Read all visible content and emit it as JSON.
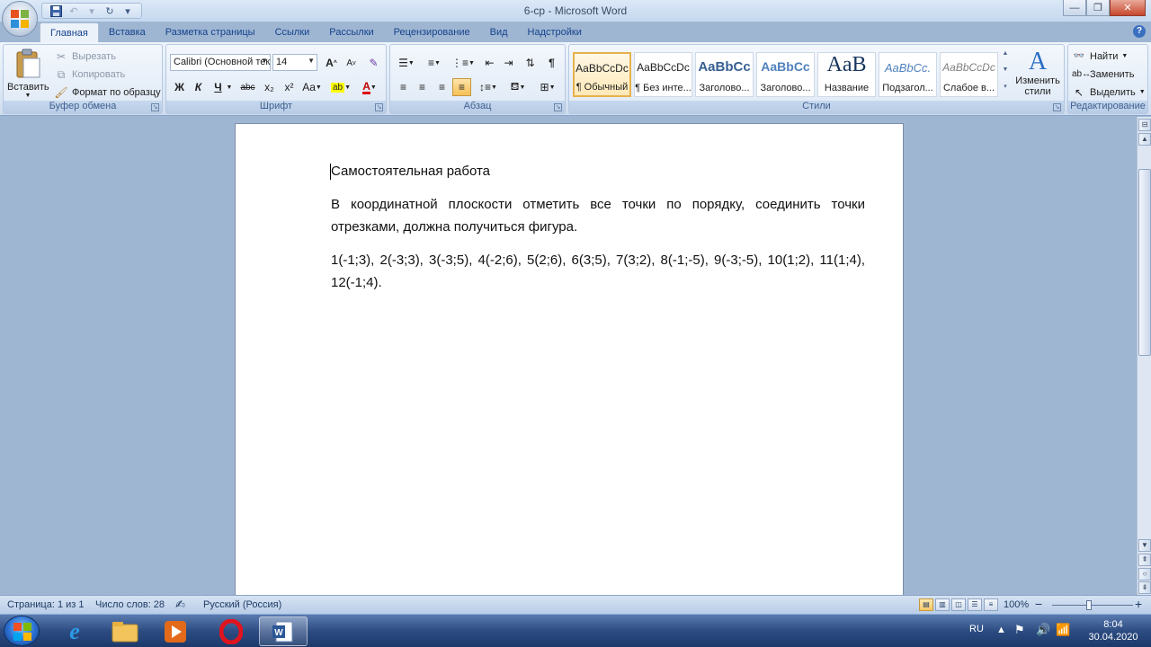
{
  "window": {
    "title": "6-ср - Microsoft Word"
  },
  "qat": {
    "save": "save-icon",
    "undo": "undo-icon",
    "redo": "redo-icon"
  },
  "tabs": [
    "Главная",
    "Вставка",
    "Разметка страницы",
    "Ссылки",
    "Рассылки",
    "Рецензирование",
    "Вид",
    "Надстройки"
  ],
  "clipboard": {
    "group_label": "Буфер обмена",
    "paste": "Вставить",
    "cut": "Вырезать",
    "copy": "Копировать",
    "format_painter": "Формат по образцу"
  },
  "font": {
    "group_label": "Шрифт",
    "font_name": "Calibri (Основной текст)",
    "font_size": "14",
    "bold": "Ж",
    "italic": "К",
    "underline": "Ч",
    "strike": "abc",
    "subscript": "x₂",
    "superscript": "x²",
    "change_case": "Aa",
    "font_color": "А",
    "grow": "A",
    "shrink": "A"
  },
  "paragraph": {
    "group_label": "Абзац",
    "show_marks": "¶"
  },
  "styles": {
    "group_label": "Стили",
    "items": [
      {
        "sample": "AaBbCcDc",
        "name": "¶ Обычный"
      },
      {
        "sample": "AaBbCcDc",
        "name": "¶ Без инте..."
      },
      {
        "sample": "AaBbCc",
        "name": "Заголово..."
      },
      {
        "sample": "AaBbCc",
        "name": "Заголово..."
      },
      {
        "sample": "AaB",
        "name": "Название"
      },
      {
        "sample": "AaBbCc.",
        "name": "Подзагол..."
      },
      {
        "sample": "AaBbCcDc",
        "name": "Слабое в..."
      }
    ],
    "change_styles": "Изменить стили"
  },
  "editing": {
    "group_label": "Редактирование",
    "find": "Найти",
    "replace": "Заменить",
    "select": "Выделить"
  },
  "document": {
    "heading": "Самостоятельная работа",
    "para1": "В координатной плоскости отметить все точки по порядку, соединить точки отрезками, должна получиться фигура.",
    "para2": "1(-1;3), 2(-3;3), 3(-3;5), 4(-2;6), 5(2;6), 6(3;5), 7(3;2), 8(-1;-5), 9(-3;-5), 10(1;2), 11(1;4), 12(-1;4)."
  },
  "status": {
    "page": "Страница: 1 из 1",
    "words": "Число слов: 28",
    "language": "Русский (Россия)",
    "zoom": "100%",
    "zoom_minus": "−",
    "zoom_plus": "+"
  },
  "taskbar": {
    "lang": "RU",
    "time": "8:04",
    "date": "30.04.2020"
  }
}
